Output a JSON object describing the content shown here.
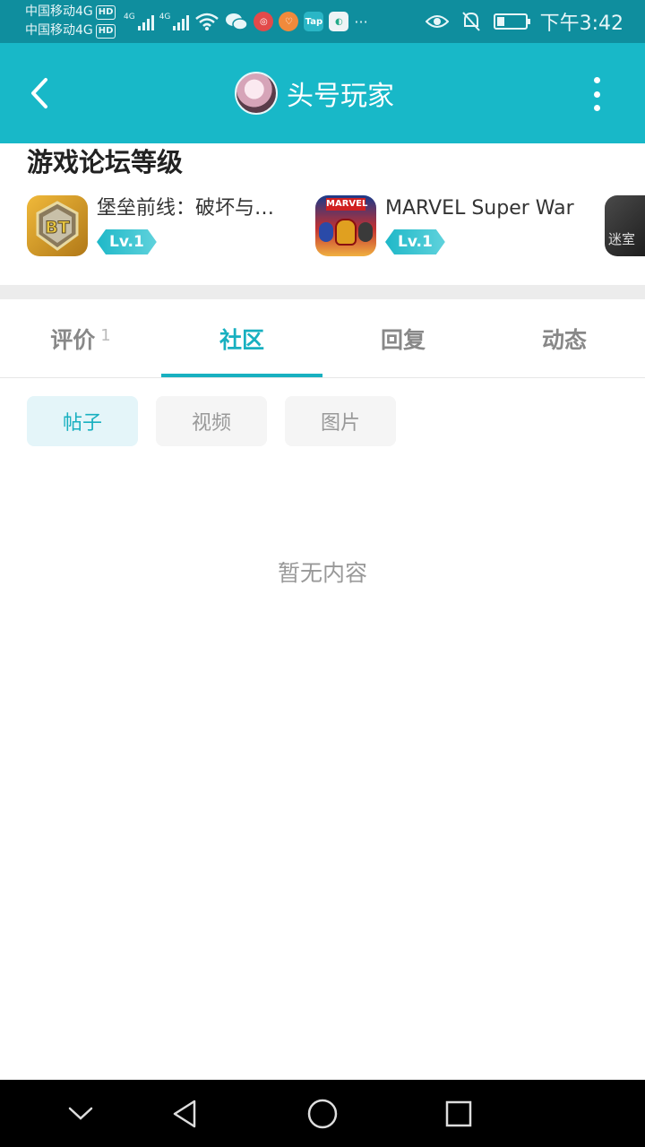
{
  "status_bar": {
    "carrier_1": "中国移动4G",
    "carrier_2": "中国移动4G",
    "hd_badge": "HD",
    "signal_label": "4G",
    "app_icons": [
      "netease-music-icon",
      "pocket-icon",
      "taptap-icon",
      "news-icon"
    ],
    "tap_label": "Tap",
    "more": "···",
    "time": "下午3:42",
    "colors": {
      "bar": "#0f8e9e"
    }
  },
  "header": {
    "title": "头号玩家",
    "accent_color": "#18b8c8"
  },
  "levels": {
    "section_title": "游戏论坛等级",
    "games": [
      {
        "name": "堡垒前线：破坏与…",
        "level": "Lv.1",
        "icon": "bt-shield-icon"
      },
      {
        "name": "MARVEL Super War",
        "level": "Lv.1",
        "icon": "marvel-heroes-icon"
      },
      {
        "name": "",
        "level": "",
        "icon": "dark-game-icon",
        "icon_text": "迷室"
      }
    ],
    "marvel_logo": "MARVEL",
    "bt_logo": "BT"
  },
  "tabs": [
    {
      "label": "评价",
      "count": "1",
      "active": false
    },
    {
      "label": "社区",
      "count": "",
      "active": true
    },
    {
      "label": "回复",
      "count": "",
      "active": false
    },
    {
      "label": "动态",
      "count": "",
      "active": false
    }
  ],
  "filters": [
    {
      "label": "帖子",
      "active": true
    },
    {
      "label": "视频",
      "active": false
    },
    {
      "label": "图片",
      "active": false
    }
  ],
  "empty_text": "暂无内容",
  "nav": [
    "collapse-icon",
    "back-triangle-icon",
    "home-circle-icon",
    "recents-square-icon"
  ]
}
